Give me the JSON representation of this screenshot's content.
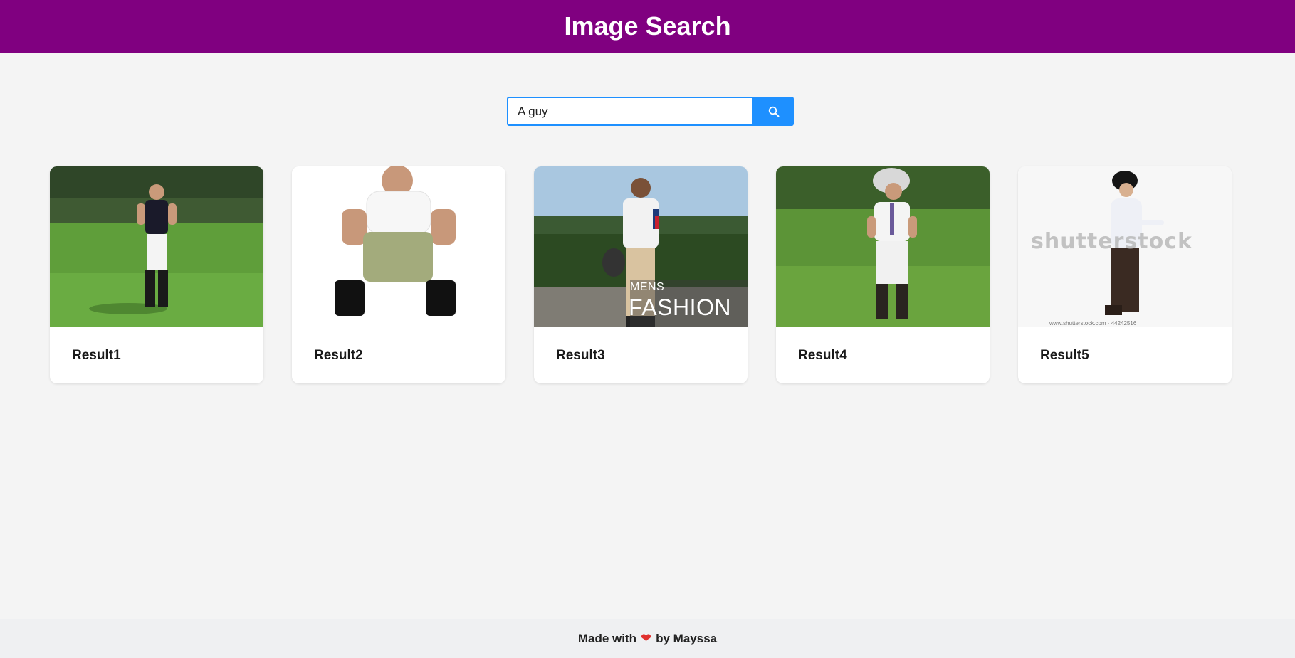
{
  "header": {
    "title": "Image Search"
  },
  "search": {
    "value": "A guy",
    "button_icon": "search-icon"
  },
  "results": [
    {
      "title": "Result1"
    },
    {
      "title": "Result2"
    },
    {
      "title": "Result3",
      "overlay_line1": "MENS",
      "overlay_line2": "FASHION"
    },
    {
      "title": "Result4"
    },
    {
      "title": "Result5",
      "watermark": "shutterstock",
      "caption": "www.shutterstock.com · 44242516"
    }
  ],
  "footer": {
    "prefix": "Made with",
    "heart": "❤",
    "suffix": "by Mayssa"
  },
  "colors": {
    "header": "#800080",
    "accent": "#1e90ff",
    "heart": "#e0312f"
  }
}
